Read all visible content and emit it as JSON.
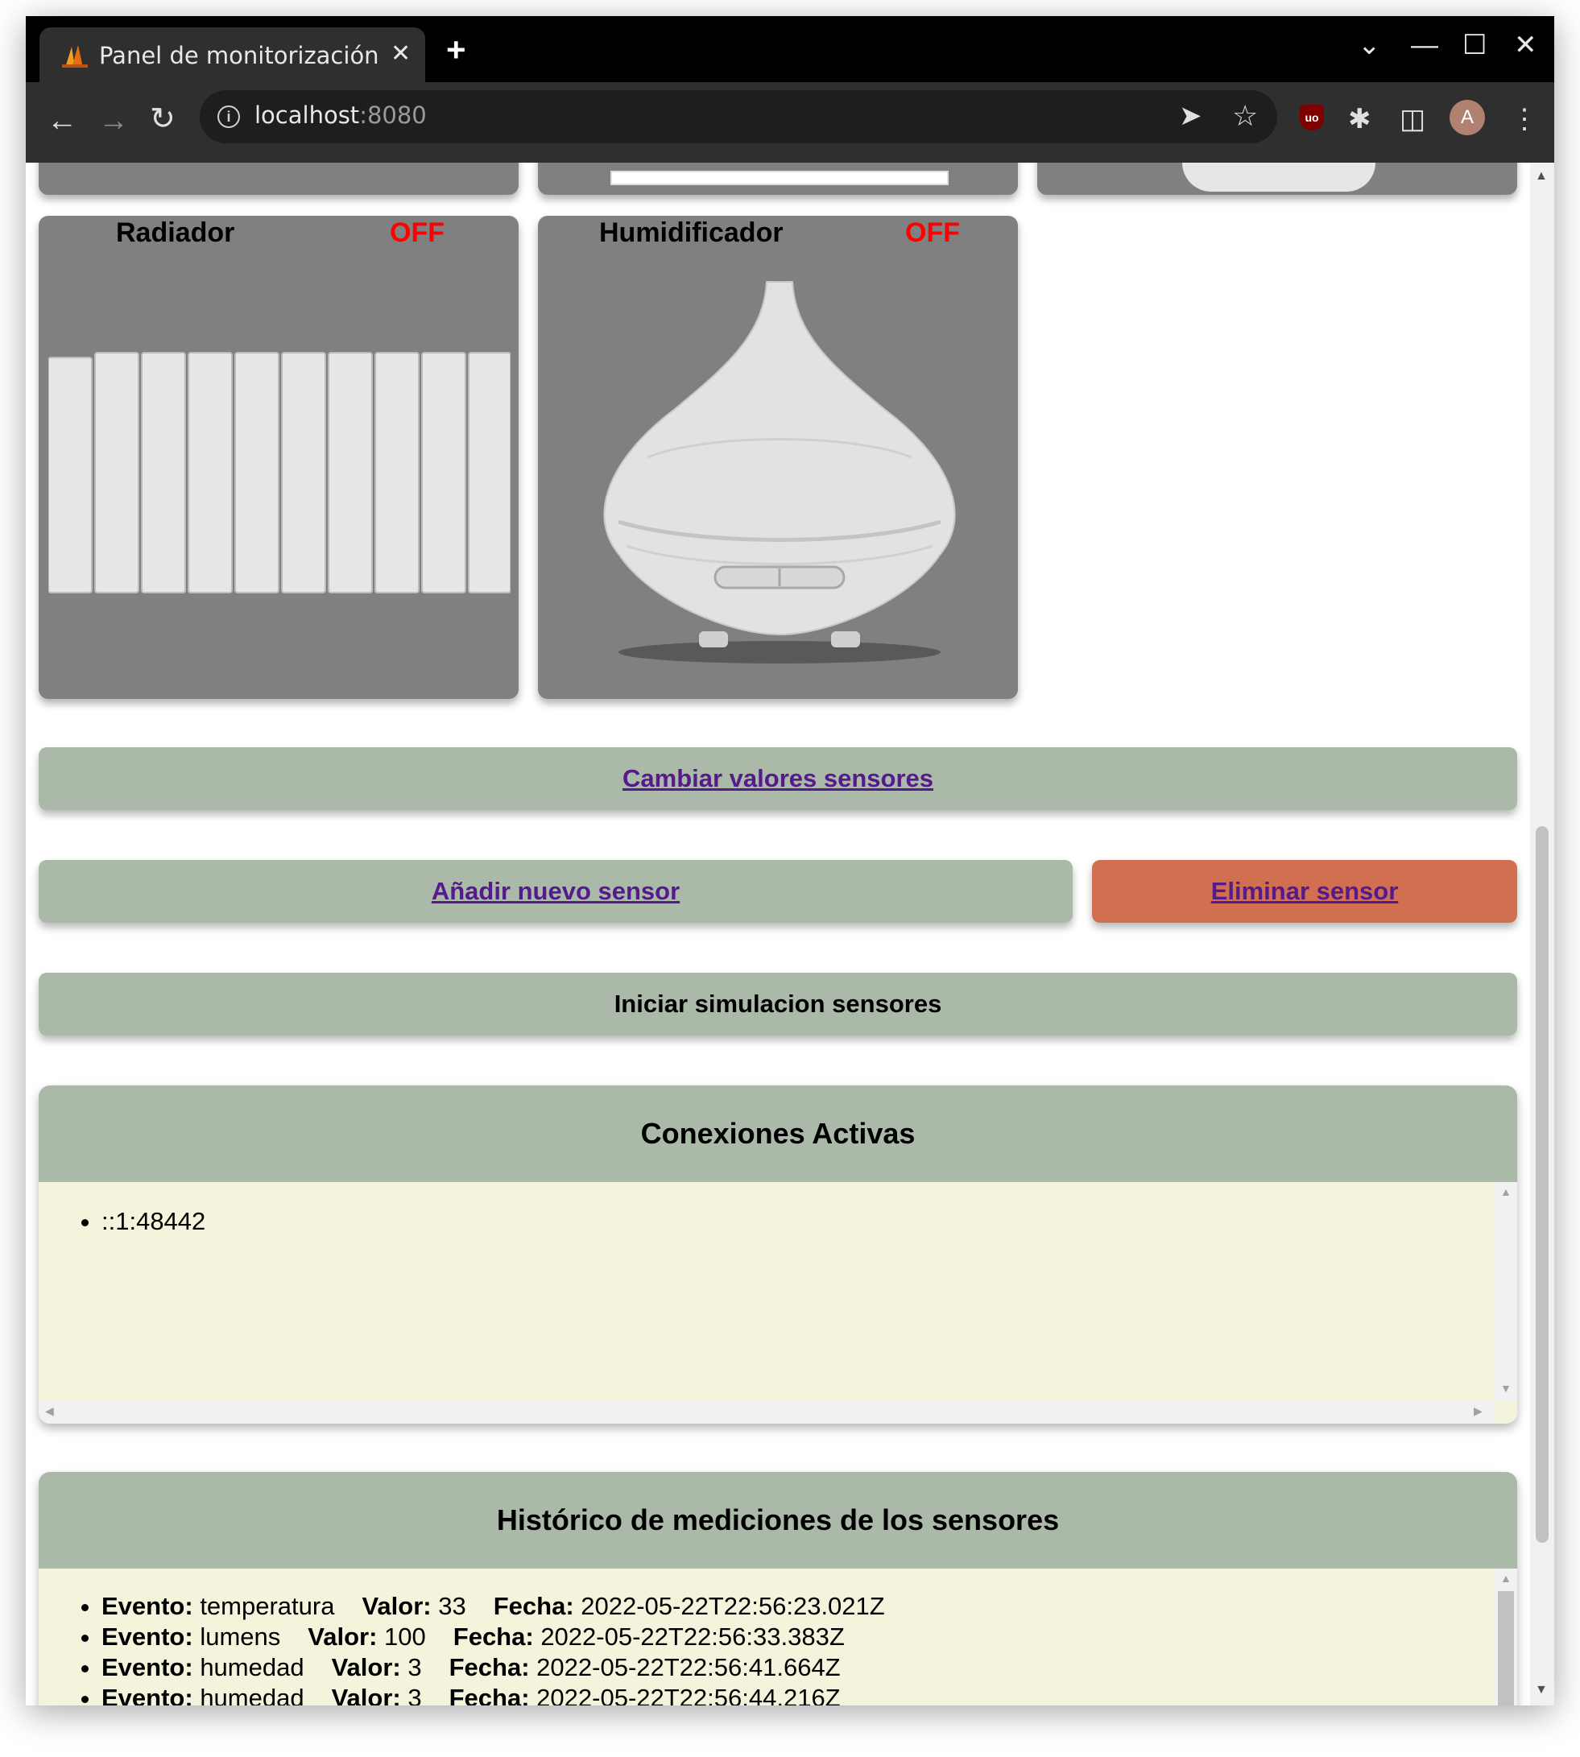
{
  "browser": {
    "tab_title": "Panel de monitorización",
    "tab_close": "✕",
    "new_tab": "+",
    "url_host": "localhost",
    "url_port": ":8080",
    "window_controls": {
      "dropdown": "⌄",
      "minimize": "—",
      "maximize": "☐",
      "close": "✕"
    },
    "profile_initial": "A",
    "ublock_label": "uo"
  },
  "devices": [
    {
      "name": "Radiador",
      "state": "OFF",
      "icon": "radiator-image"
    },
    {
      "name": "Humidificador",
      "state": "OFF",
      "icon": "humidifier-image"
    }
  ],
  "actions": {
    "change_values": "Cambiar valores sensores",
    "add_sensor": "Añadir nuevo sensor",
    "delete_sensor": "Eliminar sensor",
    "start_simulation": "Iniciar simulacion sensores"
  },
  "connections": {
    "title": "Conexiones Activas",
    "items": [
      "::1:48442"
    ]
  },
  "history": {
    "title": "Histórico de mediciones de los sensores",
    "label_event": "Evento:",
    "label_value": "Valor:",
    "label_date": "Fecha:",
    "items": [
      {
        "event": "temperatura",
        "value": "33",
        "date": "2022-05-22T22:56:23.021Z"
      },
      {
        "event": "lumens",
        "value": "100",
        "date": "2022-05-22T22:56:33.383Z"
      },
      {
        "event": "humedad",
        "value": "3",
        "date": "2022-05-22T22:56:41.664Z"
      },
      {
        "event": "humedad",
        "value": "3",
        "date": "2022-05-22T22:56:44.216Z"
      }
    ]
  },
  "colors": {
    "panel_green": "#abb9a8",
    "delete_red": "#d07050",
    "card_gray": "#808080",
    "state_off": "#ff0000",
    "panel_body": "#f4f4dc"
  }
}
